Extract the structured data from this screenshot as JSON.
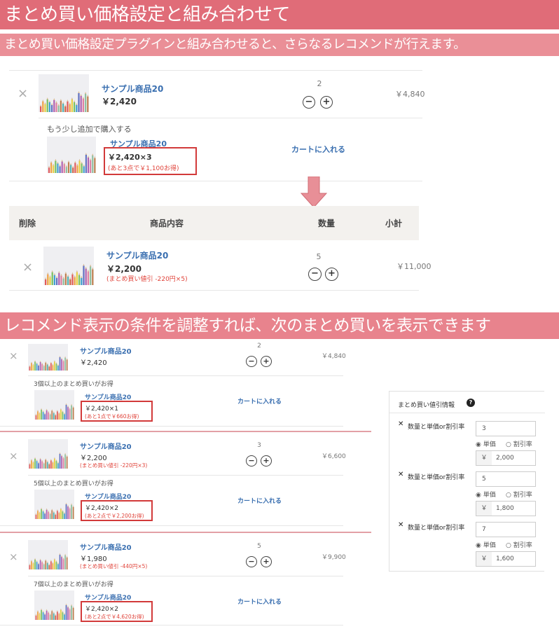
{
  "banner1": "まとめ買い価格設定と組み合わせて",
  "banner2": "まとめ買い価格設定プラグインと組み合わせると、さらなるレコメンドが行えます。",
  "banner3": "レコメンド表示の条件を調整すれば、次のまとめ買いを表示できます",
  "icons": {
    "delete": "×",
    "minus": "−",
    "plus": "+",
    "help": "?",
    "bold_x": "✕"
  },
  "colors": {
    "banner": "#e06c78",
    "link": "#3a6fb0",
    "discount": "#e0433a",
    "box": "#d23a3a"
  },
  "top": {
    "item": {
      "name": "サンプル商品20",
      "price": "￥2,420",
      "qty": "2",
      "subtotal": "￥4,840"
    },
    "reco": {
      "message": "もう少し追加で購入する",
      "name": "サンプル商品20",
      "price": "￥2,420×3",
      "note": "(あと3点で￥1,100お得)",
      "cart": "カートに入れる"
    }
  },
  "result": {
    "headers": {
      "delete": "削除",
      "product": "商品内容",
      "qty": "数量",
      "subtotal": "小計"
    },
    "item": {
      "name": "サンプル商品20",
      "price": "￥2,200",
      "discount": "(まとめ買い値引 -220円×5)",
      "qty": "5",
      "subtotal": "￥11,000"
    }
  },
  "blocks": [
    {
      "name": "サンプル商品20",
      "price": "￥2,420",
      "discount": "",
      "qty": "2",
      "subtotal": "￥4,840",
      "reco_message": "3個以上のまとめ買いがお得",
      "reco_name": "サンプル商品20",
      "reco_price": "￥2,420×1",
      "reco_note": "(あと1点で￥660お得)",
      "cart": "カートに入れる"
    },
    {
      "name": "サンプル商品20",
      "price": "￥2,200",
      "discount": "(まとめ買い値引 -220円×3)",
      "qty": "3",
      "subtotal": "￥6,600",
      "reco_message": "5個以上のまとめ買いがお得",
      "reco_name": "サンプル商品20",
      "reco_price": "￥2,420×2",
      "reco_note": "(あと2点で￥2,200お得)",
      "cart": "カートに入れる"
    },
    {
      "name": "サンプル商品20",
      "price": "￥1,980",
      "discount": "(まとめ買い値引 -440円×5)",
      "qty": "5",
      "subtotal": "￥9,900",
      "reco_message": "7個以上のまとめ買いがお得",
      "reco_name": "サンプル商品20",
      "reco_price": "￥2,420×2",
      "reco_note": "(あと2点で￥4,620お得)",
      "cart": "カートに入れる"
    }
  ],
  "panel": {
    "title": "まとめ買い値引情報",
    "rows": [
      {
        "label": "数量と単価or割引率",
        "qty": "3",
        "radio_unit": "単価",
        "radio_rate": "割引率",
        "currency": "￥",
        "value": "2,000"
      },
      {
        "label": "数量と単価or割引率",
        "qty": "5",
        "radio_unit": "単価",
        "radio_rate": "割引率",
        "currency": "￥",
        "value": "1,800"
      },
      {
        "label": "数量と単価or割引率",
        "qty": "7",
        "radio_unit": "単価",
        "radio_rate": "割引率",
        "currency": "￥",
        "value": "1,600"
      }
    ]
  }
}
